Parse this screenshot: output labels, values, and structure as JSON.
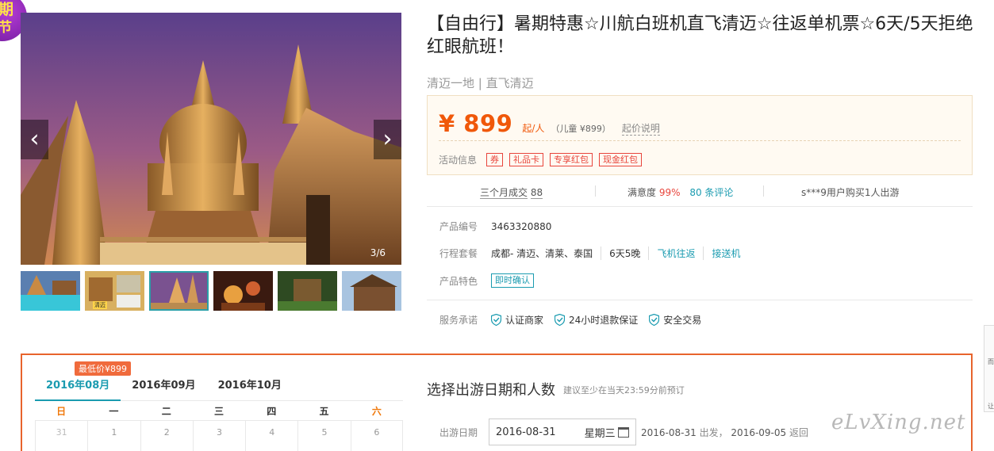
{
  "promo_badge": {
    "line1": "期",
    "line2": "节"
  },
  "gallery": {
    "counter": "3/6",
    "prev_arrow": "‹",
    "next_arrow": "›",
    "thumb_label": "清迈"
  },
  "product": {
    "title": "【自由行】暑期特惠☆川航白班机直飞清迈☆往返单机票☆6天/5天拒绝红眼航班！",
    "subtitle": "清迈一地 | 直飞清迈",
    "price": "¥ 899",
    "price_unit": "起/人",
    "child_price": "（儿童 ¥899）",
    "price_note": "起价说明",
    "promo_label": "活动信息",
    "promo_tags": [
      "券",
      "礼品卡",
      "专享红包",
      "现金红包"
    ]
  },
  "stats": {
    "deals_label": "三个月成交",
    "deals_value": "88",
    "satisfaction_label": "满意度",
    "satisfaction_value": "99%",
    "reviews": "80 条评论",
    "recent_buyer": "s***9用户购买1人出游"
  },
  "info": {
    "code_label": "产品编号",
    "code_value": "3463320880",
    "itinerary_label": "行程套餐",
    "itinerary_route": "成都- 清迈、清莱、泰国",
    "itinerary_duration": "6天5晚",
    "itinerary_flight": "飞机往返",
    "itinerary_transfer": "接送机",
    "feature_label": "产品特色",
    "feature_tag": "即时确认",
    "service_label": "服务承诺",
    "services": [
      "认证商家",
      "24小时退款保证",
      "安全交易"
    ]
  },
  "calendar": {
    "lowest_badge": "最低价¥899",
    "months": [
      "2016年08月",
      "2016年09月",
      "2016年10月"
    ],
    "weekdays": [
      "日",
      "一",
      "二",
      "三",
      "四",
      "五",
      "六"
    ],
    "first_row": [
      "31",
      "1",
      "2",
      "3",
      "4",
      "5",
      "6"
    ]
  },
  "booking": {
    "title": "选择出游日期和人数",
    "hint": "建议至少在当天23:59分前预订",
    "date_label": "出游日期",
    "date_value": "2016-08-31",
    "date_weekday": "星期三",
    "depart_date": "2016-08-31",
    "depart_word": "出发，",
    "return_date": "2016-09-05",
    "return_word": "返回"
  },
  "watermark": "eLvXing.net",
  "side_dock": {
    "a": "而",
    "b": "让"
  }
}
